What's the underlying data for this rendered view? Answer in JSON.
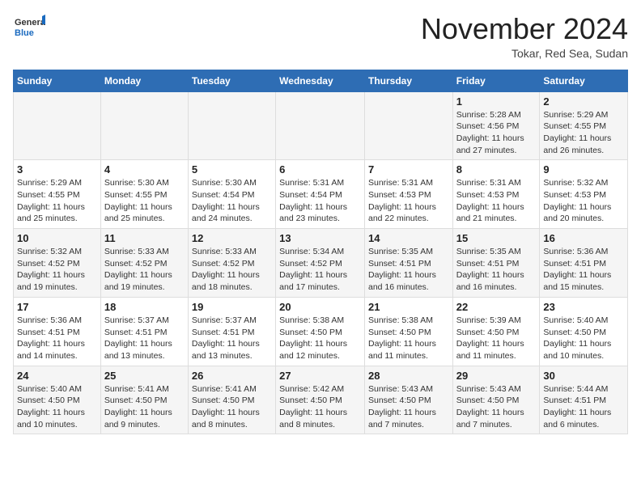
{
  "header": {
    "logo_general": "General",
    "logo_blue": "Blue",
    "month_year": "November 2024",
    "location": "Tokar, Red Sea, Sudan"
  },
  "columns": [
    "Sunday",
    "Monday",
    "Tuesday",
    "Wednesday",
    "Thursday",
    "Friday",
    "Saturday"
  ],
  "weeks": [
    [
      {
        "day": "",
        "info": ""
      },
      {
        "day": "",
        "info": ""
      },
      {
        "day": "",
        "info": ""
      },
      {
        "day": "",
        "info": ""
      },
      {
        "day": "",
        "info": ""
      },
      {
        "day": "1",
        "info": "Sunrise: 5:28 AM\nSunset: 4:56 PM\nDaylight: 11 hours\nand 27 minutes."
      },
      {
        "day": "2",
        "info": "Sunrise: 5:29 AM\nSunset: 4:55 PM\nDaylight: 11 hours\nand 26 minutes."
      }
    ],
    [
      {
        "day": "3",
        "info": "Sunrise: 5:29 AM\nSunset: 4:55 PM\nDaylight: 11 hours\nand 25 minutes."
      },
      {
        "day": "4",
        "info": "Sunrise: 5:30 AM\nSunset: 4:55 PM\nDaylight: 11 hours\nand 25 minutes."
      },
      {
        "day": "5",
        "info": "Sunrise: 5:30 AM\nSunset: 4:54 PM\nDaylight: 11 hours\nand 24 minutes."
      },
      {
        "day": "6",
        "info": "Sunrise: 5:31 AM\nSunset: 4:54 PM\nDaylight: 11 hours\nand 23 minutes."
      },
      {
        "day": "7",
        "info": "Sunrise: 5:31 AM\nSunset: 4:53 PM\nDaylight: 11 hours\nand 22 minutes."
      },
      {
        "day": "8",
        "info": "Sunrise: 5:31 AM\nSunset: 4:53 PM\nDaylight: 11 hours\nand 21 minutes."
      },
      {
        "day": "9",
        "info": "Sunrise: 5:32 AM\nSunset: 4:53 PM\nDaylight: 11 hours\nand 20 minutes."
      }
    ],
    [
      {
        "day": "10",
        "info": "Sunrise: 5:32 AM\nSunset: 4:52 PM\nDaylight: 11 hours\nand 19 minutes."
      },
      {
        "day": "11",
        "info": "Sunrise: 5:33 AM\nSunset: 4:52 PM\nDaylight: 11 hours\nand 19 minutes."
      },
      {
        "day": "12",
        "info": "Sunrise: 5:33 AM\nSunset: 4:52 PM\nDaylight: 11 hours\nand 18 minutes."
      },
      {
        "day": "13",
        "info": "Sunrise: 5:34 AM\nSunset: 4:52 PM\nDaylight: 11 hours\nand 17 minutes."
      },
      {
        "day": "14",
        "info": "Sunrise: 5:35 AM\nSunset: 4:51 PM\nDaylight: 11 hours\nand 16 minutes."
      },
      {
        "day": "15",
        "info": "Sunrise: 5:35 AM\nSunset: 4:51 PM\nDaylight: 11 hours\nand 16 minutes."
      },
      {
        "day": "16",
        "info": "Sunrise: 5:36 AM\nSunset: 4:51 PM\nDaylight: 11 hours\nand 15 minutes."
      }
    ],
    [
      {
        "day": "17",
        "info": "Sunrise: 5:36 AM\nSunset: 4:51 PM\nDaylight: 11 hours\nand 14 minutes."
      },
      {
        "day": "18",
        "info": "Sunrise: 5:37 AM\nSunset: 4:51 PM\nDaylight: 11 hours\nand 13 minutes."
      },
      {
        "day": "19",
        "info": "Sunrise: 5:37 AM\nSunset: 4:51 PM\nDaylight: 11 hours\nand 13 minutes."
      },
      {
        "day": "20",
        "info": "Sunrise: 5:38 AM\nSunset: 4:50 PM\nDaylight: 11 hours\nand 12 minutes."
      },
      {
        "day": "21",
        "info": "Sunrise: 5:38 AM\nSunset: 4:50 PM\nDaylight: 11 hours\nand 11 minutes."
      },
      {
        "day": "22",
        "info": "Sunrise: 5:39 AM\nSunset: 4:50 PM\nDaylight: 11 hours\nand 11 minutes."
      },
      {
        "day": "23",
        "info": "Sunrise: 5:40 AM\nSunset: 4:50 PM\nDaylight: 11 hours\nand 10 minutes."
      }
    ],
    [
      {
        "day": "24",
        "info": "Sunrise: 5:40 AM\nSunset: 4:50 PM\nDaylight: 11 hours\nand 10 minutes."
      },
      {
        "day": "25",
        "info": "Sunrise: 5:41 AM\nSunset: 4:50 PM\nDaylight: 11 hours\nand 9 minutes."
      },
      {
        "day": "26",
        "info": "Sunrise: 5:41 AM\nSunset: 4:50 PM\nDaylight: 11 hours\nand 8 minutes."
      },
      {
        "day": "27",
        "info": "Sunrise: 5:42 AM\nSunset: 4:50 PM\nDaylight: 11 hours\nand 8 minutes."
      },
      {
        "day": "28",
        "info": "Sunrise: 5:43 AM\nSunset: 4:50 PM\nDaylight: 11 hours\nand 7 minutes."
      },
      {
        "day": "29",
        "info": "Sunrise: 5:43 AM\nSunset: 4:50 PM\nDaylight: 11 hours\nand 7 minutes."
      },
      {
        "day": "30",
        "info": "Sunrise: 5:44 AM\nSunset: 4:51 PM\nDaylight: 11 hours\nand 6 minutes."
      }
    ]
  ]
}
